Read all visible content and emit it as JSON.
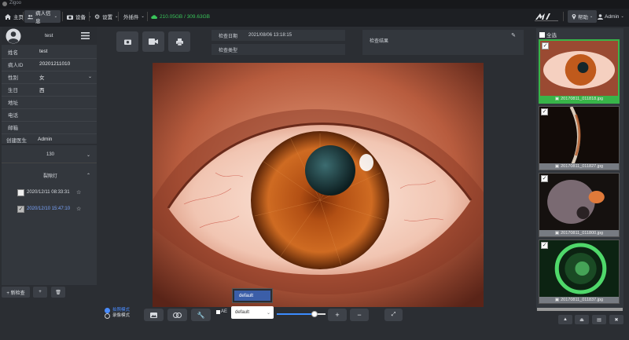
{
  "window": {
    "title": "Zigoo"
  },
  "menu": {
    "home": "主页",
    "patient_info": "病人信息",
    "device": "设备",
    "settings": "设置",
    "plugins": "外插件",
    "storage": "210.05GB / 309.63GB",
    "help": "帮助",
    "user": "Admin"
  },
  "patient": {
    "name_label": "姓名",
    "name_value": "test",
    "id_label": "病人ID",
    "id_value": "20201211010",
    "gender_label": "性别",
    "gender_value": "女",
    "birth_label": "生日",
    "birth_value": "西",
    "address_label": "地址",
    "address_value": "",
    "phone_label": "电话",
    "phone_value": "",
    "email_label": "邮箱",
    "email_value": "",
    "doctor_label": "创建医生",
    "doctor_value": "Admin",
    "header_name": "test"
  },
  "exams": {
    "group_label": "130",
    "section_label": "裂隙灯",
    "items": [
      {
        "date": "2020/12/11 08:33:31",
        "checked": false
      },
      {
        "date": "2020/12/10 15:47:10",
        "checked": true
      }
    ],
    "add_button": "+ 新检查",
    "plus_button": "+"
  },
  "info": {
    "exam_date_label": "检查日期",
    "exam_date_value": "2021/08/06 13:18:15",
    "exam_type_label": "检查类型",
    "result_label": "检查结果"
  },
  "capture": {
    "mode_shoot": "拍照模式",
    "mode_record": "录像模式",
    "ae_label": "AE",
    "preset_value": "default",
    "preset_popup": "default",
    "zoom_level": 0.78
  },
  "thumbnails": {
    "select_all": "全选",
    "items": [
      {
        "name": "20170811_011818.jpg",
        "checked": true,
        "selected": true
      },
      {
        "name": "20170811_011827.jpg",
        "checked": true,
        "selected": false
      },
      {
        "name": "20170811_011800.jpg",
        "checked": true,
        "selected": false
      },
      {
        "name": "20170811_011837.jpg",
        "checked": true,
        "selected": false
      }
    ]
  },
  "colors": {
    "accent_green": "#38b449",
    "storage_green": "#39c45a",
    "highlight_blue": "#3b5ea8"
  }
}
